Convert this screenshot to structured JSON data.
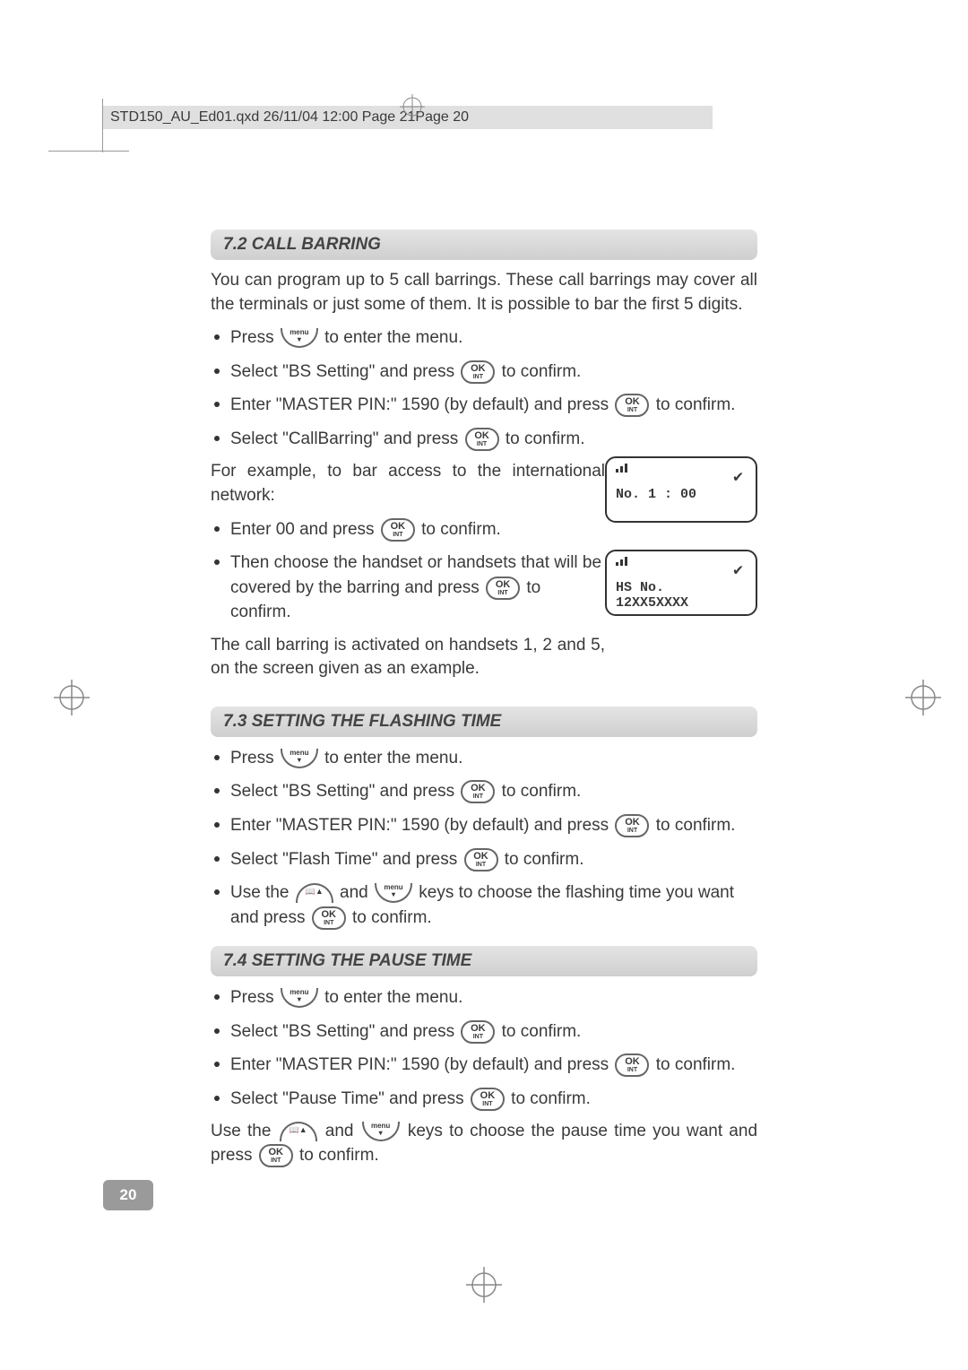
{
  "file_header": "STD150_AU_Ed01.qxd  26/11/04  12:00  Page 21Page 20",
  "page_number": "20",
  "sec72": {
    "heading": "7.2   CALL BARRING",
    "intro": "You can program up to 5 call barrings. These call barrings may cover all the terminals or just some of them.  It is possible to bar the first 5 digits.",
    "li1a": "Press ",
    "li1b": " to enter the menu.",
    "li2a": "Select \"BS Setting\" and press ",
    "li2b": " to confirm.",
    "li3a": "Enter \"MASTER PIN:\" 1590 (by default) and press ",
    "li3b": " to confirm.",
    "li4a": "Select \"CallBarring\" and press ",
    "li4b": " to confirm.",
    "example_line": "For example, to bar access to the international network:",
    "li5a": "Enter 00 and press ",
    "li5b": " to confirm.",
    "li6a": "Then choose the handset or handsets that will be covered by the barring and press ",
    "li6b": " to confirm.",
    "result": "The call barring is activated on handsets 1, 2 and 5, on the screen given as an example.",
    "lcd1_line1": "No. 1 : 00",
    "lcd2_line1": "HS No.",
    "lcd2_line2": "12XX5XXXX"
  },
  "sec73": {
    "heading": "7.3   SETTING THE FLASHING TIME",
    "li1a": "Press ",
    "li1b": " to enter the menu.",
    "li2a": "Select \"BS Setting\" and press ",
    "li2b": " to confirm.",
    "li3a": "Enter \"MASTER PIN:\" 1590 (by default) and press ",
    "li3b": " to confirm.",
    "li4a": "Select \"Flash Time\" and press ",
    "li4b": " to confirm.",
    "li5a": "Use the ",
    "li5b": " and ",
    "li5c": " keys to choose the flashing time you want and press ",
    "li5d": " to confirm."
  },
  "sec74": {
    "heading": "7.4   SETTING THE PAUSE TIME",
    "li1a": "Press ",
    "li1b": " to enter the menu.",
    "li2a": "Select \"BS Setting\" and press ",
    "li2b": " to confirm.",
    "li3a": "Enter \"MASTER PIN:\" 1590 (by default) and press ",
    "li3b": " to confirm.",
    "li4a": "Select \"Pause Time\" and press ",
    "li4b": " to confirm.",
    "end_a": "Use the ",
    "end_b": " and ",
    "end_c": " keys to choose the pause time you want and press ",
    "end_d": " to confirm."
  },
  "btn_ok_top": "OK",
  "btn_ok_bot": "INT",
  "btn_menu": "menu",
  "btn_dial": "📖▲",
  "signal_icon": "▮▮▮",
  "check_icon": "✔"
}
